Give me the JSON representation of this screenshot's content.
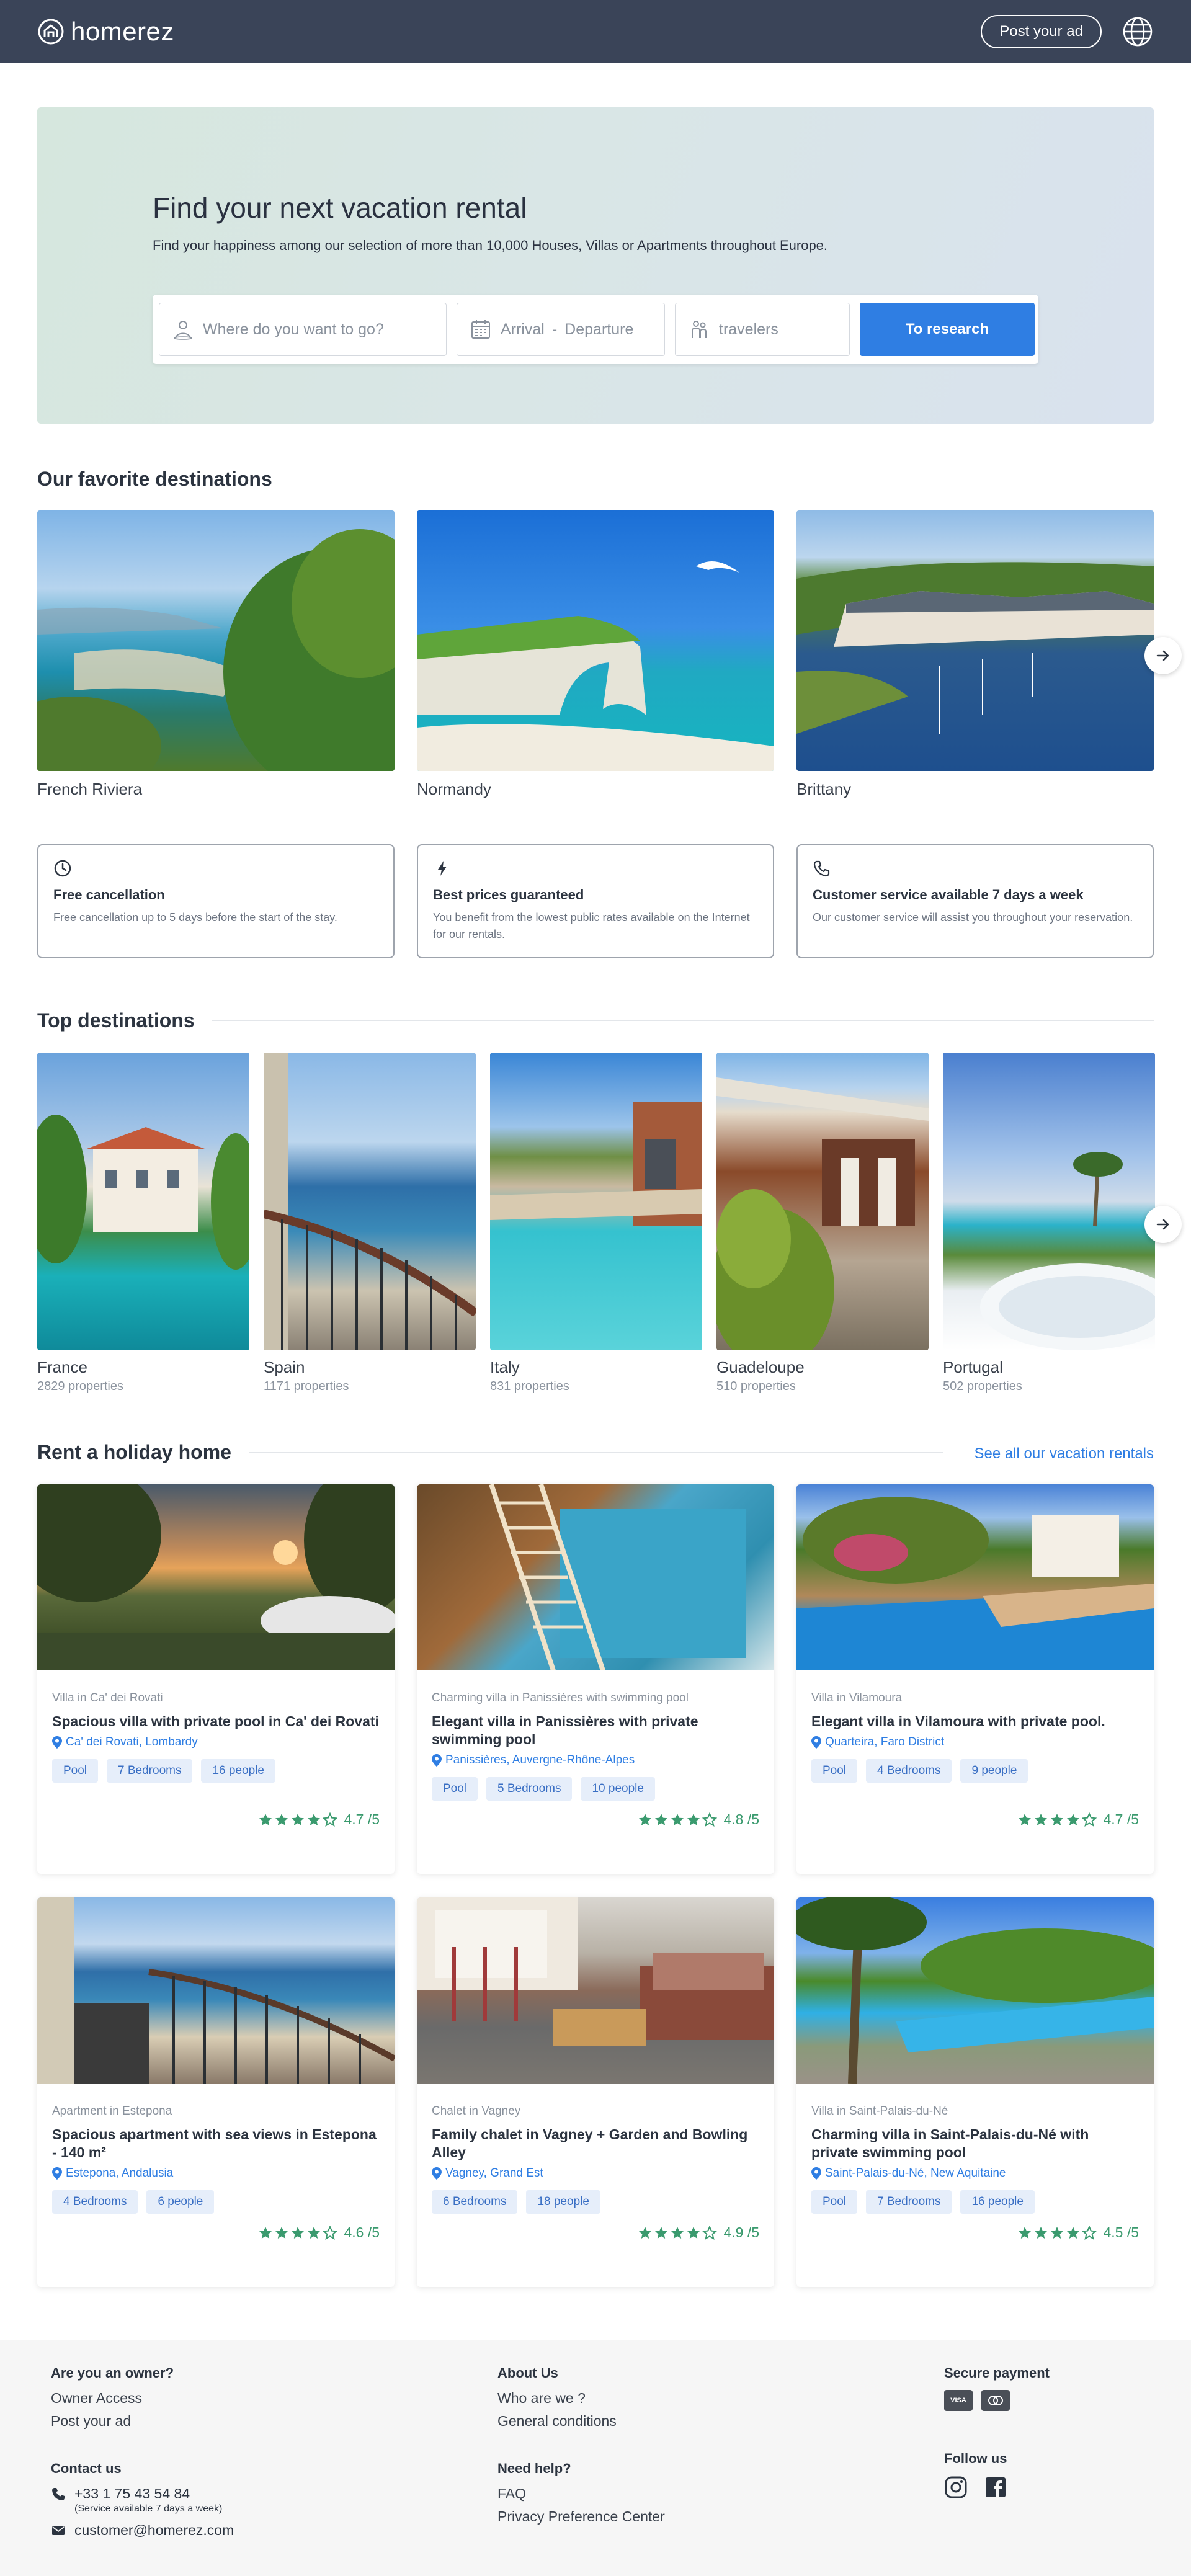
{
  "header": {
    "logo_text": "homerez",
    "post_ad_label": "Post your ad",
    "language_icon": "globe-icon"
  },
  "hero": {
    "title": "Find your next vacation rental",
    "subtitle": "Find your happiness among our selection of more than 10,000 Houses, Villas or Apartments throughout Europe.",
    "where_placeholder": "Where do you want to go?",
    "arrival_placeholder": "Arrival",
    "separator": "-",
    "departure_placeholder": "Departure",
    "travelers_placeholder": "travelers",
    "search_label": "To research"
  },
  "favorites": {
    "title": "Our favorite destinations",
    "items": [
      {
        "label": "French Riviera"
      },
      {
        "label": "Normandy"
      },
      {
        "label": "Brittany"
      }
    ]
  },
  "features": [
    {
      "icon": "clock-icon",
      "title": "Free cancellation",
      "text": "Free cancellation up to 5 days before the start of the stay."
    },
    {
      "icon": "lightning-icon",
      "title": "Best prices guaranteed",
      "text": "You benefit from the lowest public rates available on the Internet for our rentals."
    },
    {
      "icon": "phone-icon",
      "title": "Customer service available 7 days a week",
      "text": "Our customer service will assist you throughout your reservation."
    }
  ],
  "top": {
    "title": "Top destinations",
    "items": [
      {
        "name": "France",
        "count": "2829 properties"
      },
      {
        "name": "Spain",
        "count": "1171 properties"
      },
      {
        "name": "Italy",
        "count": "831 properties"
      },
      {
        "name": "Guadeloupe",
        "count": "510 properties"
      },
      {
        "name": "Portugal",
        "count": "502 properties"
      }
    ]
  },
  "rentals": {
    "title": "Rent a holiday home",
    "see_all": "See all our vacation rentals",
    "items": [
      {
        "type": "Villa in Ca' dei Rovati",
        "title": "Spacious villa with private pool in Ca' dei Rovati",
        "location": "Ca' dei Rovati, Lombardy",
        "tags": [
          "Pool",
          "7 Bedrooms",
          "16 people"
        ],
        "rating": "4.7 /5",
        "stars": 4
      },
      {
        "type": "Charming villa in Panissières with swimming pool",
        "title": "Elegant villa in Panissières with private swimming pool",
        "location": "Panissières, Auvergne-Rhône-Alpes",
        "tags": [
          "Pool",
          "5 Bedrooms",
          "10 people"
        ],
        "rating": "4.8 /5",
        "stars": 4
      },
      {
        "type": "Villa in Vilamoura",
        "title": "Elegant villa in Vilamoura with private pool.",
        "location": "Quarteira, Faro District",
        "tags": [
          "Pool",
          "4 Bedrooms",
          "9 people"
        ],
        "rating": "4.7 /5",
        "stars": 4
      },
      {
        "type": "Apartment in Estepona",
        "title": "Spacious apartment with sea views in Estepona - 140 m²",
        "location": "Estepona, Andalusia",
        "tags": [
          "4 Bedrooms",
          "6 people"
        ],
        "rating": "4.6 /5",
        "stars": 4
      },
      {
        "type": "Chalet in Vagney",
        "title": "Family chalet in Vagney + Garden and Bowling Alley",
        "location": "Vagney, Grand Est",
        "tags": [
          "6 Bedrooms",
          "18 people"
        ],
        "rating": "4.9 /5",
        "stars": 4
      },
      {
        "type": "Villa in Saint-Palais-du-Né",
        "title": "Charming villa in Saint-Palais-du-Né with private swimming pool",
        "location": "Saint-Palais-du-Né, New Aquitaine",
        "tags": [
          "Pool",
          "7 Bedrooms",
          "16 people"
        ],
        "rating": "4.5 /5",
        "stars": 4
      }
    ]
  },
  "footer": {
    "owner_title": "Are you an owner?",
    "owner_links": [
      "Owner Access",
      "Post your ad"
    ],
    "contact_title": "Contact us",
    "phone": "+33 1 75 43 54 84",
    "phone_note": "(Service available 7 days a week)",
    "email": "customer@homerez.com",
    "about_title": "About Us",
    "about_links": [
      "Who are we ?",
      "General conditions"
    ],
    "help_title": "Need help?",
    "help_links": [
      "FAQ",
      "Privacy Preference Center"
    ],
    "payment_title": "Secure payment",
    "payment_icons": [
      "VISA",
      "MC"
    ],
    "follow_title": "Follow us",
    "social_icons": [
      "instagram-icon",
      "facebook-icon"
    ]
  },
  "colors": {
    "header_bg": "#3a4458",
    "accent": "#2f7ee3",
    "rating_green": "#3a9a6e",
    "tag_bg": "#e6eefa"
  }
}
